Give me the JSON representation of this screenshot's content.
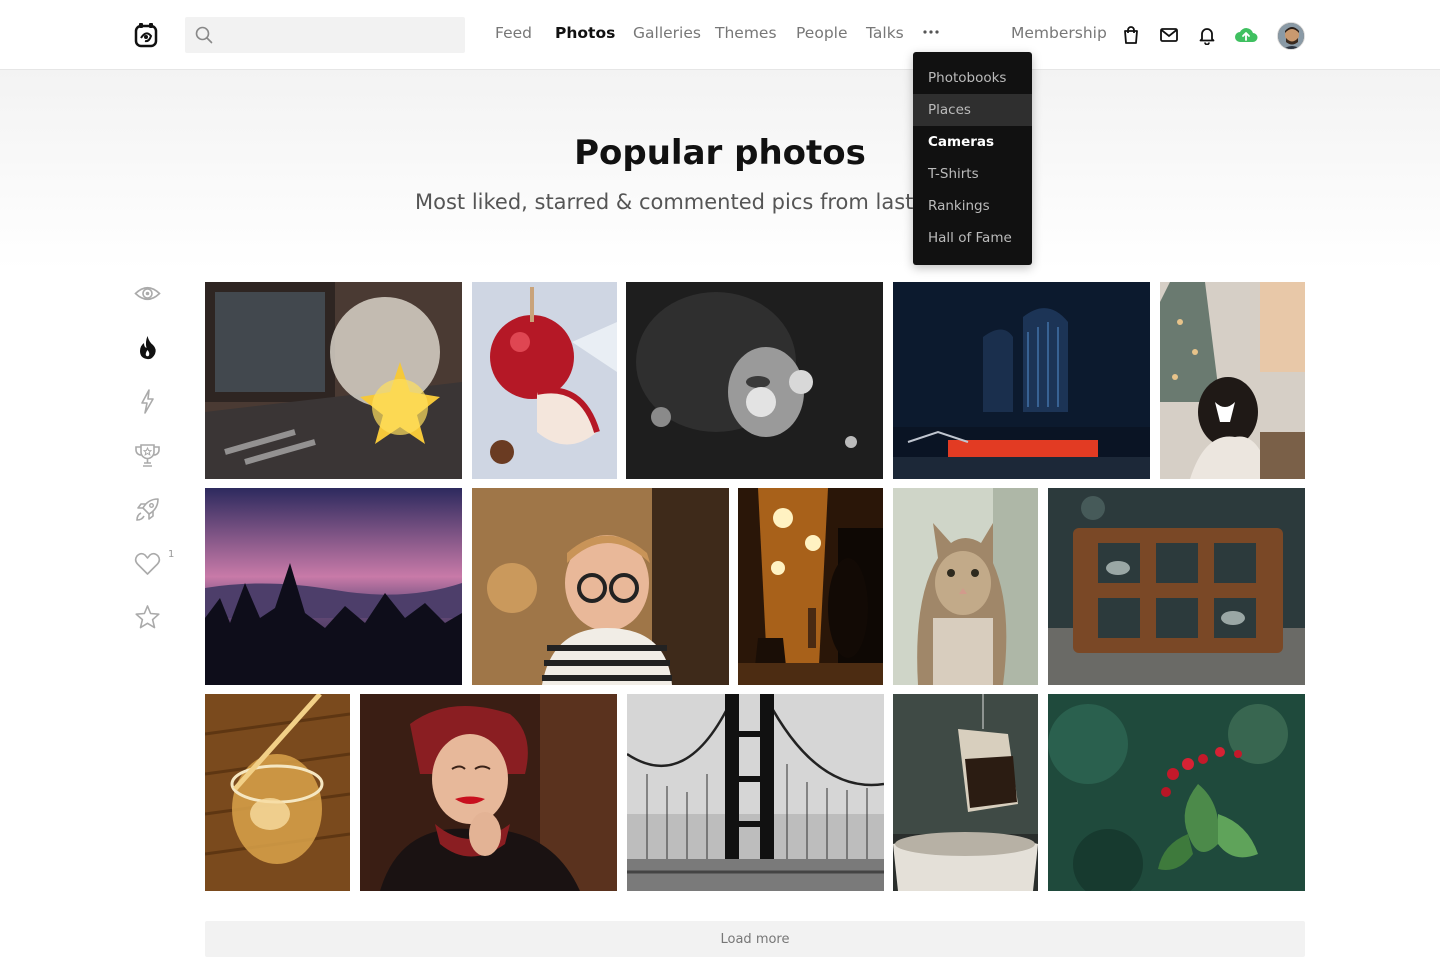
{
  "search": {
    "placeholder": ""
  },
  "nav": {
    "items": [
      {
        "label": "Feed",
        "active": false
      },
      {
        "label": "Photos",
        "active": true
      },
      {
        "label": "Galleries",
        "active": false
      },
      {
        "label": "Themes",
        "active": false
      },
      {
        "label": "People",
        "active": false
      },
      {
        "label": "Talks",
        "active": false
      }
    ],
    "more_icon": "more-dots-icon",
    "membership": "Membership"
  },
  "header_icons": [
    "shopping-bag-icon",
    "mail-icon",
    "bell-icon",
    "upload-cloud-icon"
  ],
  "colors": {
    "upload_accent": "#3fc060",
    "dropdown_bg": "#111111",
    "active_text": "#111111"
  },
  "dropdown": {
    "items": [
      {
        "label": "Photobooks",
        "state": "normal"
      },
      {
        "label": "Places",
        "state": "hover"
      },
      {
        "label": "Cameras",
        "state": "active"
      },
      {
        "label": "T-Shirts",
        "state": "normal"
      },
      {
        "label": "Rankings",
        "state": "normal"
      },
      {
        "label": "Hall of Fame",
        "state": "normal"
      }
    ]
  },
  "hero": {
    "title": "Popular photos",
    "subtitle": "Most liked, starred & commented pics from last"
  },
  "sidebar": {
    "icons": [
      "eye-icon",
      "fire-icon",
      "lightning-icon",
      "trophy-icon",
      "rocket-icon",
      "heart-icon",
      "star-icon"
    ],
    "active": "fire-icon",
    "heart_count": "1"
  },
  "photos": [
    "explosion-window-photo",
    "candy-apple-photo",
    "bw-portrait-photo",
    "toronto-sign-photo",
    "christmas-tree-photo",
    "pink-sunset-forest-photo",
    "boy-glasses-photo",
    "night-street-photo",
    "cat-looking-up-photo",
    "rusty-brick-photo",
    "whiskey-glass-photo",
    "woman-red-lips-photo",
    "bridge-bw-photo",
    "tea-bag-photo",
    "red-berries-photo"
  ],
  "load_more": "Load more"
}
